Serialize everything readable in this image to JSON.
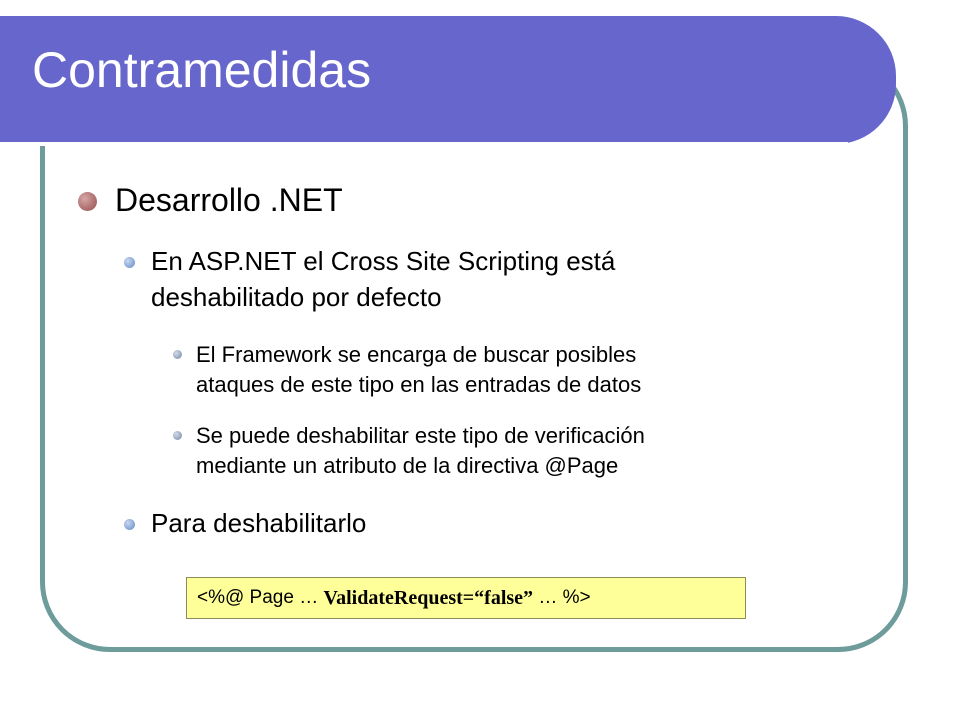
{
  "slide": {
    "title": "Contramedidas",
    "colors": {
      "title_bar": "#6666cc",
      "frame_border": "#6d9c9a",
      "bullet_level1": "#b27373",
      "bullet_level2": "#8aa8d8",
      "bullet_level3": "#98a8c0",
      "code_box_bg": "#ffff99"
    },
    "bullets": [
      {
        "level": 1,
        "text": "Desarrollo .NET"
      },
      {
        "level": 2,
        "lines": [
          "En ASP.NET el Cross Site Scripting está",
          "deshabilitado por defecto"
        ]
      },
      {
        "level": 3,
        "lines": [
          "El Framework se encarga de buscar posibles",
          "ataques de este tipo en las entradas de datos"
        ]
      },
      {
        "level": 3,
        "lines": [
          "Se puede deshabilitar este tipo de verificación",
          "mediante un atributo de la directiva @Page"
        ]
      },
      {
        "level": 2,
        "text": "Para deshabilitarlo"
      }
    ],
    "code": {
      "prefix": "<%@ Page … ",
      "highlight": "ValidateRequest=“false”",
      "suffix": " … %>"
    }
  }
}
